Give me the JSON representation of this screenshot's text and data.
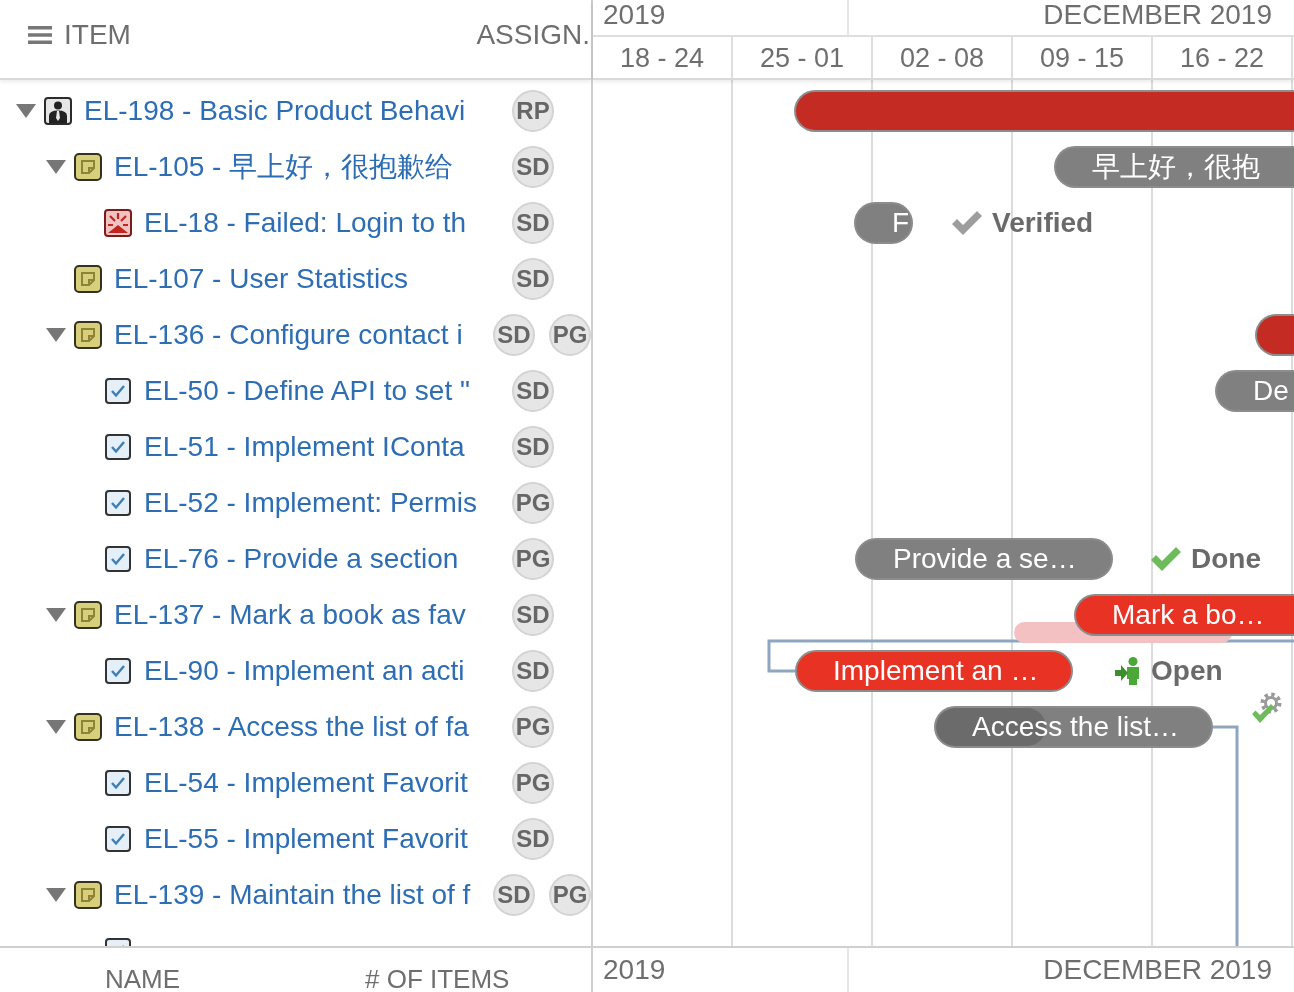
{
  "item_list": {
    "columns": [
      "ITEM",
      "ASSIGN."
    ],
    "items": [
      {
        "title": "EL-198 - Basic Product Behavi",
        "kind": "epic",
        "expanded": true,
        "assignees": [
          "RP"
        ],
        "bar": {
          "color": "#c42b22"
        },
        "children": [
          {
            "title": "EL-105 - 早上好，很抱歉给",
            "kind": "feature",
            "expanded": true,
            "assignees": [
              "SD"
            ],
            "bar": {
              "label": "早上好，很抱",
              "color": "#808080"
            },
            "children": [
              {
                "title": "EL-18 - Failed: Login to th",
                "kind": "defect",
                "assignees": [
                  "SD"
                ],
                "bar": {
                  "label": "F",
                  "color": "#808080",
                  "status": {
                    "kind": "verified",
                    "label": "Verified"
                  }
                }
              }
            ]
          },
          {
            "title": "EL-107 - User Statistics",
            "kind": "feature",
            "assignees": [
              "SD"
            ]
          },
          {
            "title": "EL-136 - Configure contact i",
            "kind": "feature",
            "expanded": true,
            "assignees": [
              "SD",
              "PG"
            ],
            "bar": {
              "color": "#c42b22"
            },
            "children": [
              {
                "title": "EL-50 - Define API to set \"",
                "kind": "task",
                "assignees": [
                  "SD"
                ],
                "bar": {
                  "label": "De",
                  "color": "#808080"
                }
              },
              {
                "title": "EL-51 - Implement IConta",
                "kind": "task",
                "assignees": [
                  "SD"
                ]
              },
              {
                "title": "EL-52 - Implement: Permis",
                "kind": "task",
                "assignees": [
                  "PG"
                ]
              },
              {
                "title": "EL-76 - Provide a section",
                "kind": "task",
                "assignees": [
                  "PG"
                ],
                "bar": {
                  "label": "Provide a se…",
                  "color": "#808080",
                  "status": {
                    "kind": "done",
                    "label": "Done"
                  }
                }
              }
            ]
          },
          {
            "title": "EL-137 - Mark a book as fav",
            "kind": "feature",
            "expanded": true,
            "assignees": [
              "SD"
            ],
            "bar": {
              "label": "Mark a bo…",
              "color": "#e83224",
              "baseline": true
            },
            "children": [
              {
                "title": "EL-90 - Implement an acti",
                "kind": "task",
                "assignees": [
                  "SD"
                ],
                "bar": {
                  "label": "Implement an …",
                  "color": "#e83224",
                  "status": {
                    "kind": "open",
                    "label": "Open"
                  }
                }
              }
            ]
          },
          {
            "title": "EL-138 - Access the list of fa",
            "kind": "feature",
            "expanded": true,
            "assignees": [
              "PG"
            ],
            "bar": {
              "label": "Access the list…",
              "color": "#808080",
              "level": 0.4,
              "status": {
                "kind": "in_progress"
              }
            },
            "children": [
              {
                "title": "EL-54 - Implement Favorit",
                "kind": "task",
                "assignees": [
                  "PG"
                ]
              },
              {
                "title": "EL-55 - Implement Favorit",
                "kind": "task",
                "assignees": [
                  "SD"
                ]
              }
            ]
          },
          {
            "title": "EL-139 - Maintain the list of f",
            "kind": "feature",
            "expanded": true,
            "assignees": [
              "SD",
              "PG"
            ],
            "children": [
              {
                "kind": "task"
              }
            ]
          }
        ]
      }
    ]
  },
  "timeline": {
    "months": [
      "2019",
      "DECEMBER 2019"
    ],
    "weeks": [
      "18 - 24",
      "25 - 01",
      "02 - 08",
      "09 - 15",
      "16 - 22"
    ]
  },
  "footer": {
    "columns": [
      "NAME",
      "# OF ITEMS"
    ],
    "months": [
      "2019",
      "DECEMBER 2019"
    ]
  }
}
